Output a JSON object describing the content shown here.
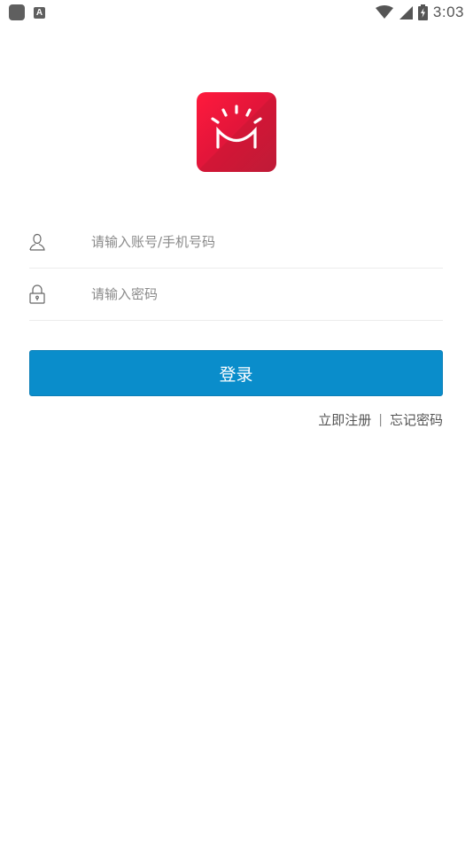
{
  "status_bar": {
    "time": "3:03",
    "left_icons": [
      "app-notification-icon",
      "a-icon"
    ],
    "right_icons": [
      "wifi-icon",
      "cellular-signal-icon",
      "battery-charging-icon"
    ],
    "a_glyph": "A"
  },
  "logo": {
    "icon": "smile-bag-logo",
    "colors": [
      "#ff1a3d",
      "#c81d3b"
    ]
  },
  "form": {
    "account": {
      "placeholder": "请输入账号/手机号码",
      "value": "",
      "icon": "user-icon"
    },
    "password": {
      "placeholder": "请输入密码",
      "value": "",
      "icon": "lock-icon"
    },
    "login_label": "登录",
    "accent_color": "#0a8dcb"
  },
  "links": {
    "register": "立即注册",
    "separator": "|",
    "forgot": "忘记密码"
  }
}
